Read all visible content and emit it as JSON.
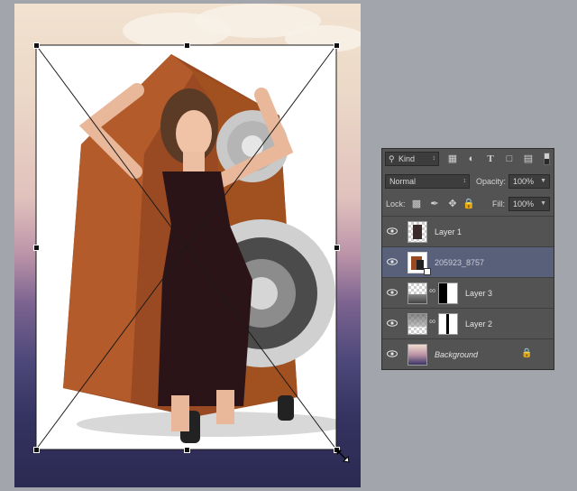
{
  "layers_panel": {
    "filter": {
      "kind_label": "Kind"
    },
    "blend_mode": "Normal",
    "opacity": {
      "label": "Opacity:",
      "value": "100%"
    },
    "lock": {
      "label": "Lock:"
    },
    "fill": {
      "label": "Fill:",
      "value": "100%"
    },
    "layers": [
      {
        "name": "Layer 1",
        "selected": false
      },
      {
        "name": "205923_8757",
        "selected": true
      },
      {
        "name": "Layer 3",
        "selected": false
      },
      {
        "name": "Layer 2",
        "selected": false
      },
      {
        "name": "Background",
        "selected": false
      }
    ]
  },
  "icons": {
    "filter": "search-icon",
    "visibility": "eye-icon",
    "link": "chain-link-icon",
    "lock": "padlock-icon",
    "resize_cursor": "diagonal-resize-cursor-icon"
  },
  "colors": {
    "panel_bg": "#535353",
    "selected_row": "#59607a",
    "workspace_bg": "#a2a5ab"
  }
}
